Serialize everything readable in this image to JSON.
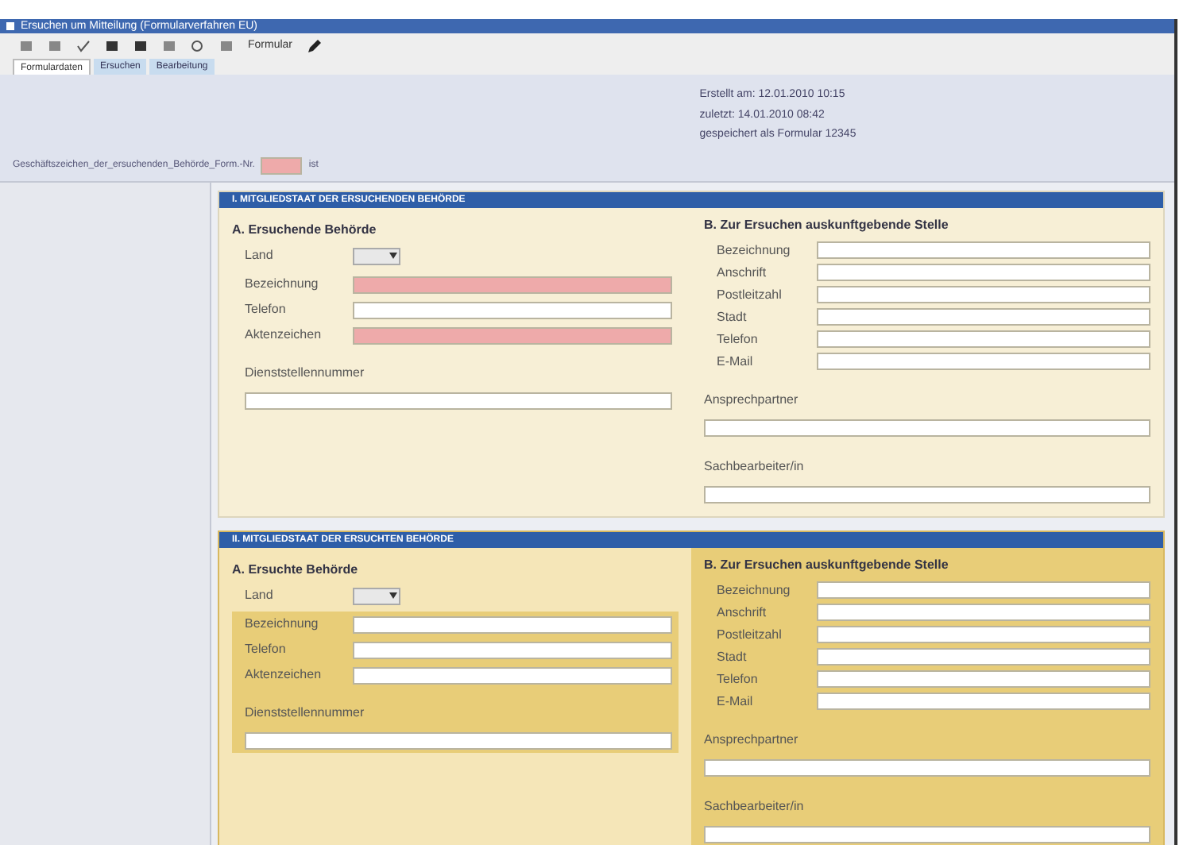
{
  "window": {
    "title": "Ersuchen um Mitteilung (Formularverfahren EU)"
  },
  "toolbar": {
    "format_label": "Formular"
  },
  "tabs": [
    {
      "label": "Formulardaten",
      "selected": true
    },
    {
      "label": "Ersuchen",
      "selected": false
    },
    {
      "label": "Bearbeitung",
      "selected": false
    }
  ],
  "info": {
    "lines": [
      "Erstellt am: 12.01.2010 10:15",
      "zuletzt: 14.01.2010 08:42",
      "gespeichert als Formular 12345"
    ]
  },
  "reference": {
    "label": "Geschäftszeichen_der_ersuchenden_Behörde_Form.-Nr.",
    "required": true,
    "suffix": "ist"
  },
  "sections": [
    {
      "heading": "I. MITGLIEDSTAAT DER ERSUCHENDEN BEHÖRDE",
      "highlight": false,
      "left": {
        "heading": "A. Ersuchende Behörde",
        "country_label": "Land",
        "rows": [
          {
            "label": "Bezeichnung",
            "required": true
          },
          {
            "label": "Telefon",
            "required": false
          },
          {
            "label": "Aktenzeichen",
            "required": true
          }
        ],
        "wide": [
          {
            "label": "Dienststellennummer"
          }
        ]
      },
      "right": {
        "heading": "B. Zur Ersuchen auskunftgebende Stelle",
        "rows": [
          {
            "label": "Bezeichnung"
          },
          {
            "label": "Anschrift"
          },
          {
            "label": "Postleitzahl"
          },
          {
            "label": "Stadt"
          },
          {
            "label": "Telefon"
          },
          {
            "label": "E-Mail"
          }
        ],
        "wide": [
          {
            "label": "Ansprechpartner"
          },
          {
            "label": "Sachbearbeiter/in"
          }
        ]
      }
    },
    {
      "heading": "II. MITGLIEDSTAAT DER ERSUCHTEN BEHÖRDE",
      "highlight": true,
      "left": {
        "heading": "A. Ersuchte Behörde",
        "country_label": "Land",
        "rows": [
          {
            "label": "Bezeichnung",
            "required": false
          },
          {
            "label": "Telefon",
            "required": false
          },
          {
            "label": "Aktenzeichen",
            "required": false
          }
        ],
        "wide": [
          {
            "label": "Dienststellennummer"
          }
        ]
      },
      "right": {
        "heading": "B. Zur Ersuchen auskunftgebende Stelle",
        "rows": [
          {
            "label": "Bezeichnung"
          },
          {
            "label": "Anschrift"
          },
          {
            "label": "Postleitzahl"
          },
          {
            "label": "Stadt"
          },
          {
            "label": "Telefon"
          },
          {
            "label": "E-Mail"
          }
        ],
        "wide": [
          {
            "label": "Ansprechpartner"
          },
          {
            "label": "Sachbearbeiter/in"
          }
        ]
      }
    }
  ]
}
